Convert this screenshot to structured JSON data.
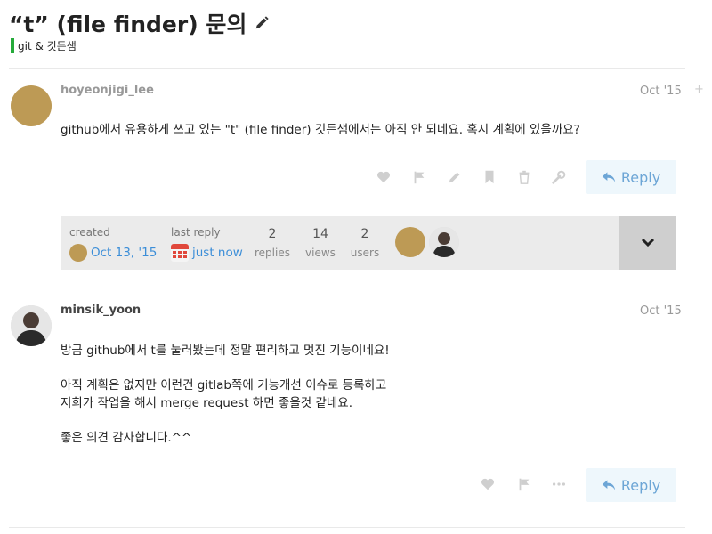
{
  "topic": {
    "title": "“t” (file finder) 문의",
    "category": "git & 깃든샘",
    "category_color": "#25aa3a"
  },
  "posts": [
    {
      "username": "hoyeonjigi_lee",
      "date": "Oct '15",
      "paragraphs": [
        "github에서 유용하게 쓰고 있는 \"t\" (file finder) 깃든샘에서는 아직 안 되네요. 혹시 계획에 있을까요?"
      ],
      "actions": [
        "heart-icon",
        "flag-icon",
        "pencil-icon",
        "bookmark-icon",
        "trash-icon",
        "wrench-icon"
      ],
      "reply_label": "Reply",
      "side_marker": "+"
    },
    {
      "username": "minsik_yoon",
      "date": "Oct '15",
      "paragraphs": [
        "방금 github에서 t를 눌러봤는데 정말 편리하고 멋진 기능이네요!",
        "아직 계획은 없지만 이런건 gitlab쪽에 기능개선 이슈로 등록하고",
        "저희가 작업을 해서 merge request 하면 좋을것 같네요.",
        "좋은 의견 감사합니다.^^"
      ],
      "actions": [
        "heart-icon",
        "flag-icon",
        "more-icon"
      ],
      "reply_label": "Reply"
    }
  ],
  "topic_map": {
    "created_label": "created",
    "created_value": "Oct 13, '15",
    "last_reply_label": "last reply",
    "last_reply_value": "just now",
    "replies_count": "2",
    "replies_label": "replies",
    "views_count": "14",
    "views_label": "views",
    "users_count": "2",
    "users_label": "users",
    "expand_icon": "chevron-down-icon"
  },
  "colors": {
    "accent_link": "#3c8ed8",
    "reply_text": "#6da6d6",
    "reply_bg": "#eef7fc",
    "avatar_gold": "#bd9a55"
  }
}
